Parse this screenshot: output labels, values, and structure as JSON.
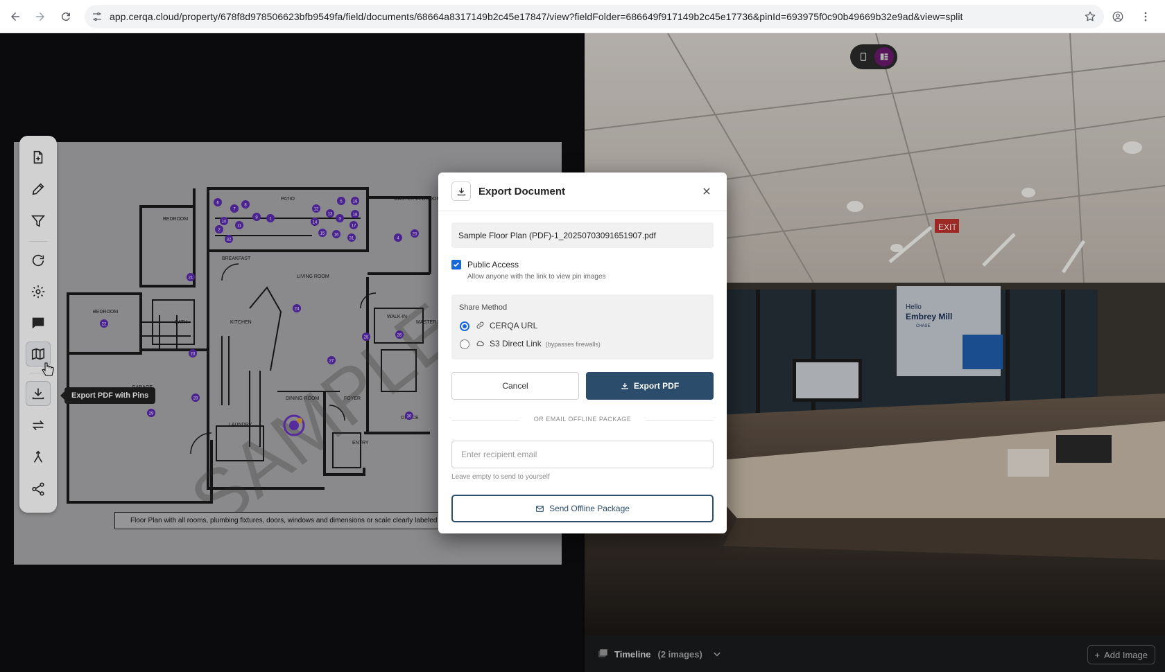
{
  "browser": {
    "url": "app.cerqa.cloud/property/678f8d978506623bfb9549fa/field/documents/68664a8317149b2c45e17847/view?fieldFolder=686649f917149b2c45e17736&pinId=693975f0c90b49669b32e9ad&view=split",
    "icons": [
      "back-arrow-icon",
      "forward-arrow-icon",
      "reload-icon",
      "tune-icon",
      "star-icon",
      "account-icon",
      "more-vert-icon"
    ]
  },
  "toolbar": {
    "tooltip": "Export PDF with Pins",
    "items": [
      "add-document-icon",
      "pencil-icon",
      "filter-icon",
      "refresh-icon",
      "gear-icon",
      "comment-icon",
      "map-icon",
      "download-icon",
      "swap-icon",
      "merge-icon",
      "share-icon"
    ]
  },
  "floor_plan": {
    "caption": "Floor Plan with all rooms, plumbing fixtures, doors, windows and dimensions or scale clearly labeled",
    "watermark": "SAMPLE",
    "rooms": [
      "PATIO",
      "MASTER BEDROOM",
      "BEDROOM",
      "BREAKFAST NOOK",
      "LIVING ROOM",
      "BEDROOM",
      "KITCHEN",
      "BATH",
      "WALK-IN CLOSET",
      "MASTER BATH",
      "GARAGE",
      "LAUNDRY",
      "DINING ROOM",
      "FOYER",
      "ENTRY",
      "OFFICE"
    ],
    "pins": [
      "1",
      "2",
      "3",
      "4",
      "5",
      "6",
      "7",
      "8",
      "9",
      "10",
      "11",
      "12",
      "13",
      "14",
      "15",
      "16",
      "17",
      "18",
      "19",
      "20",
      "21",
      "22",
      "23",
      "24",
      "25",
      "26",
      "27",
      "28",
      "29",
      "30",
      "31",
      "32"
    ]
  },
  "modal": {
    "title": "Export Document",
    "filename": "Sample Floor Plan (PDF)-1_20250703091651907.pdf",
    "public_access_label": "Public Access",
    "public_access_checked": true,
    "public_access_desc": "Allow anyone with the link to view pin images",
    "share_method_title": "Share Method",
    "options": [
      {
        "label": "CERQA URL",
        "note": "",
        "selected": true
      },
      {
        "label": "S3 Direct Link",
        "note": "(bypasses firewalls)",
        "selected": false
      }
    ],
    "cancel_label": "Cancel",
    "export_label": "Export PDF",
    "or_label": "OR EMAIL OFFLINE PACKAGE",
    "email_placeholder": "Enter recipient email",
    "email_value": "",
    "email_help": "Leave empty to send to yourself",
    "send_label": "Send Offline Package"
  },
  "viewer": {
    "scene_text": [
      "Hello",
      "Embrey Mill",
      "CHASE",
      "EXIT"
    ],
    "timeline_label": "Timeline",
    "timeline_count": "(2 images)",
    "add_image_label": "Add Image"
  },
  "colors": {
    "accent": "#2b4c6a",
    "checkbox": "#1668d8",
    "pin": "#5b2bb0",
    "toggle_active": "#6b1a6d"
  }
}
